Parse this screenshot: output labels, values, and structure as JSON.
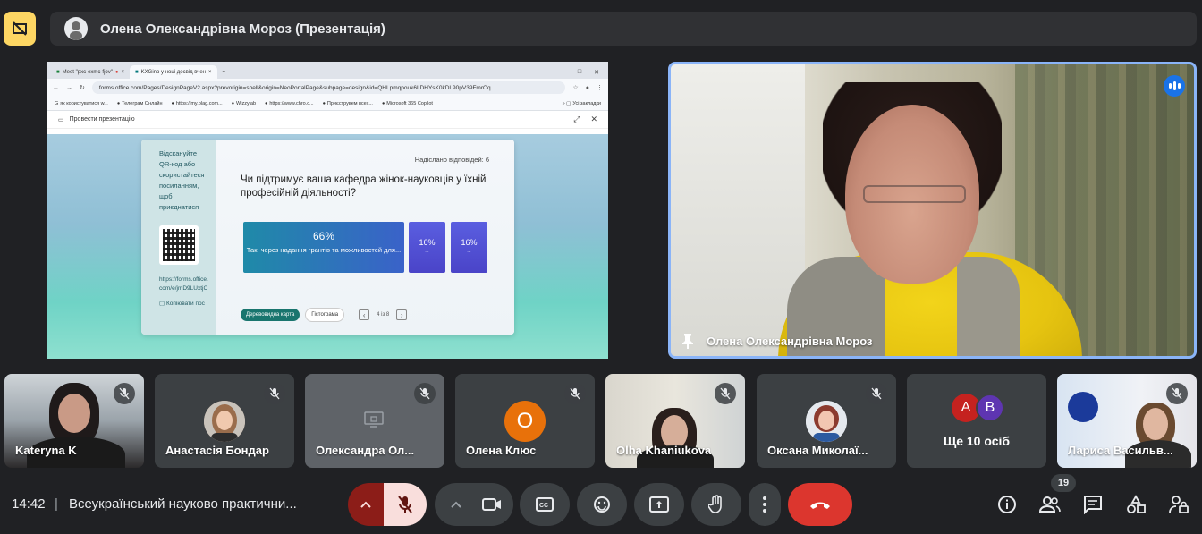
{
  "presenter_bar": {
    "title": "Олена Олександрівна Мороз (Презентація)"
  },
  "browser": {
    "tabs": [
      {
        "label": "Meet \"pxc-exmc-fjov\""
      },
      {
        "label": "KXGino y ноці досвід вчен"
      }
    ],
    "url": "forms.office.com/Pages/DesignPageV2.aspx?prevorigin=shell&origin=NeoPortalPage&subpage=design&id=QHLpmqpouk6LDHYsK0kDL90pV39FmrOq...",
    "bookmarks": [
      "як користуватися w...",
      "Телеграм Онлайн",
      "https://my.plag.com...",
      "Wizzylab",
      "https://www.chro.c...",
      "Приєструвем всех...",
      "Microsoft 365 Copilot",
      "Усі закладки"
    ],
    "present_header": "Провести презентацію"
  },
  "slide": {
    "sidebar_text": "Відскануйте QR-код або скористайтеся посиланням, щоб приєднатися",
    "link_text": "https://forms.office.com/e/jmD9LUxtjC",
    "copy_label": "Копіювати пос",
    "sent_label": "Надіслано відповідей: 6",
    "question": "Чи підтримує ваша кафедра жінок-науковців у їхній професійній діяльності?",
    "bars": [
      {
        "pct": "66%",
        "label": "Так, через надання грантів та можливостей для..."
      },
      {
        "pct": "16%",
        "label": "..."
      },
      {
        "pct": "16%",
        "label": "..."
      }
    ],
    "view_tree": "Деревовидна карта",
    "view_hist": "Гістограма",
    "pager": "4 із 8"
  },
  "speaker": {
    "name": "Олена Олександрівна Мороз"
  },
  "tiles": [
    {
      "name": "Kateryna K"
    },
    {
      "name": "Анастасія Бондар"
    },
    {
      "name": "Олександра Ол..."
    },
    {
      "name": "Олена Клюс",
      "initial": "О",
      "color": "#e8710a"
    },
    {
      "name": "Olha Khaniukova"
    },
    {
      "name": "Оксана Миколаї..."
    },
    {
      "name": "Ще 10 осіб",
      "initials": [
        "А",
        "В"
      ],
      "colors": [
        "#c5221f",
        "#5e35b1"
      ]
    },
    {
      "name": "Лариса Васильв..."
    }
  ],
  "bottom": {
    "time": "14:42",
    "separator": "|",
    "meeting_title": "Всеукраїнський науково практични...",
    "participants_count": "19"
  }
}
